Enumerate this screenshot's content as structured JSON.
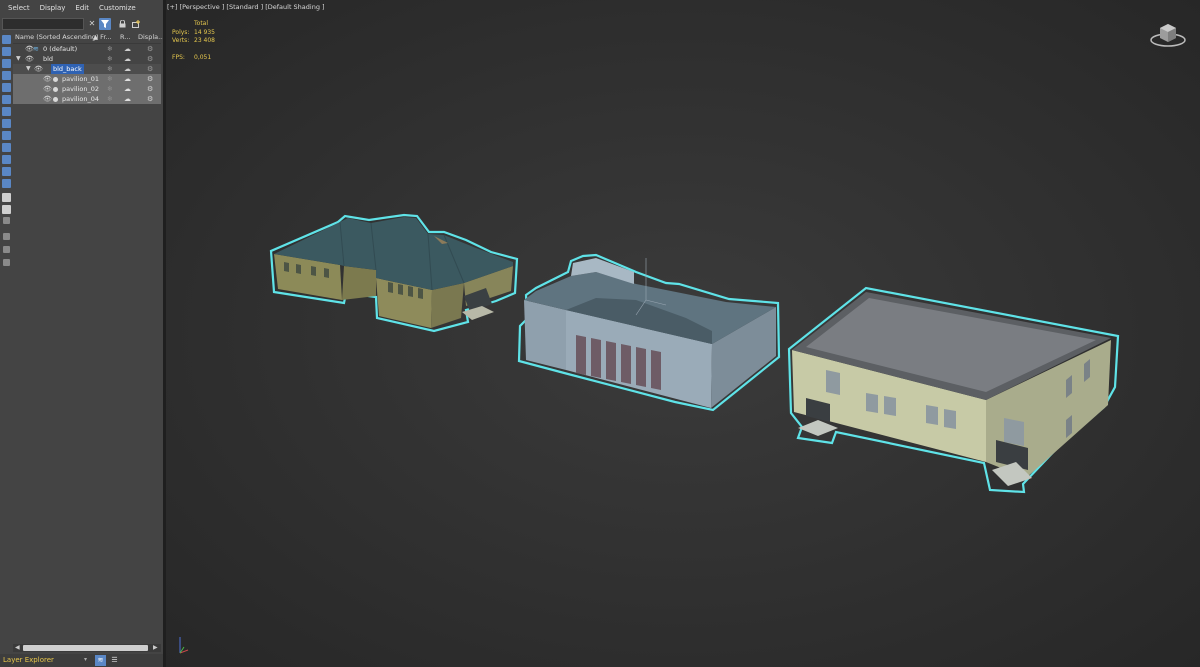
{
  "explorer": {
    "menu": [
      "Select",
      "Display",
      "Edit",
      "Customize"
    ],
    "search": {
      "value": "",
      "placeholder": ""
    },
    "columns": {
      "name": "Name (Sorted Ascending)",
      "frozen": "▲ Fr...",
      "render": "R...",
      "display": "Displa..."
    },
    "rows": [
      {
        "label": "0 (default)",
        "type": "layer"
      },
      {
        "label": "bld",
        "type": "layer"
      },
      {
        "label": "bld_back",
        "type": "layer"
      },
      {
        "label": "pavilion_01",
        "type": "object"
      },
      {
        "label": "pavilion_02",
        "type": "object"
      },
      {
        "label": "pavilion_04",
        "type": "object"
      }
    ],
    "status_label": "Layer Explorer"
  },
  "viewport": {
    "label": "[+] [Perspective ] [Standard ] [Default Shading ]",
    "stats": {
      "header": "Total",
      "polys_label": "Polys:",
      "polys_value": "14 935",
      "verts_label": "Verts:",
      "verts_value": "23 408",
      "fps_label": "FPS:",
      "fps_value": "0,051"
    },
    "selection_color": "#5fe3e8"
  },
  "colors": {
    "accent": "#5a87c5",
    "status_text": "#e9c74b",
    "panel_bg": "#444444"
  }
}
